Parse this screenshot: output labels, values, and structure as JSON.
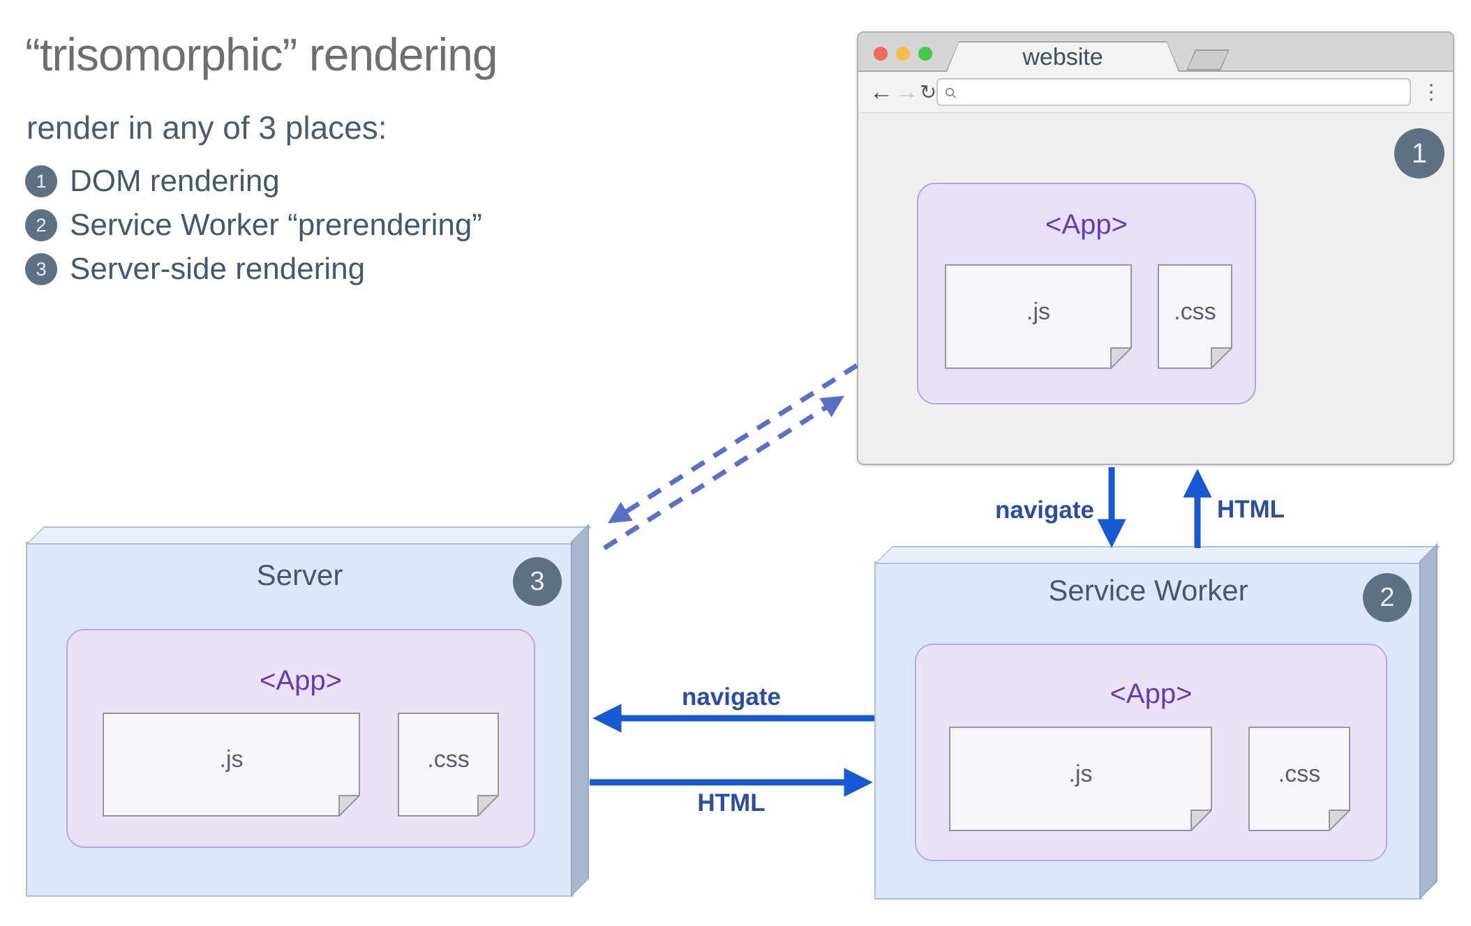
{
  "intro": {
    "title": "“trisomorphic” rendering",
    "subtitle": "render in any of 3 places:",
    "items": [
      {
        "num": "1",
        "label": "DOM rendering"
      },
      {
        "num": "2",
        "label": "Service Worker “prerendering”"
      },
      {
        "num": "3",
        "label": "Server-side rendering"
      }
    ]
  },
  "browser": {
    "tab_title": "website",
    "badge": "1",
    "nav": {
      "back": "←",
      "forward": "→",
      "reload": "↻",
      "menu": "⋮"
    },
    "url_value": "",
    "url_placeholder": "",
    "app": {
      "title": "<App>",
      "js_label": ".js",
      "css_label": ".css"
    }
  },
  "server": {
    "title": "Server",
    "badge": "3",
    "app": {
      "title": "<App>",
      "js_label": ".js",
      "css_label": ".css"
    }
  },
  "service_worker": {
    "title": "Service Worker",
    "badge": "2",
    "app": {
      "title": "<App>",
      "js_label": ".js",
      "css_label": ".css"
    }
  },
  "arrows": {
    "navigate_down": "navigate",
    "html_up": "HTML",
    "navigate_left": "navigate",
    "html_right": "HTML"
  },
  "colors": {
    "solid_arrow": "#1659d2",
    "dashed_arrow": "#5b6fc8",
    "arrow_label": "#2b4d9e",
    "badge_bg": "#5d7183",
    "app_purple": "#6639b7",
    "slate_text": "#47586c",
    "box_blue": "#dce8fa",
    "app_lavender": "#e7e0f7"
  }
}
